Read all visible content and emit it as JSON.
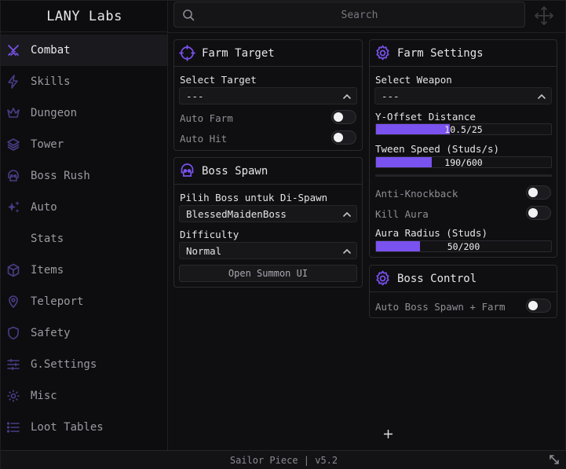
{
  "app": {
    "title": "LANY Labs"
  },
  "colors": {
    "accent": "#7a52ef",
    "background": "#0f0f11",
    "panel_border": "#2a2a2e"
  },
  "search": {
    "placeholder": "Search"
  },
  "sidebar": {
    "items": [
      {
        "label": "Combat",
        "icon": "swords-icon",
        "active": true
      },
      {
        "label": "Skills",
        "icon": "lightning-icon"
      },
      {
        "label": "Dungeon",
        "icon": "crown-icon"
      },
      {
        "label": "Tower",
        "icon": "layers-icon"
      },
      {
        "label": "Boss Rush",
        "icon": "skull-icon"
      },
      {
        "label": "Auto",
        "icon": "sparkles-icon"
      },
      {
        "label": "Stats",
        "icon": ""
      },
      {
        "label": "Items",
        "icon": "cube-icon"
      },
      {
        "label": "Teleport",
        "icon": "map-pin-icon"
      },
      {
        "label": "Safety",
        "icon": "shield-icon"
      },
      {
        "label": "G.Settings",
        "icon": "sliders-icon"
      },
      {
        "label": "Misc",
        "icon": "gear-icon"
      },
      {
        "label": "Loot Tables",
        "icon": "list-icon"
      }
    ]
  },
  "farm_target": {
    "title": "Farm Target",
    "select_target_label": "Select Target",
    "select_target_value": "---",
    "auto_farm_label": "Auto Farm",
    "auto_farm_on": false,
    "auto_hit_label": "Auto Hit",
    "auto_hit_on": false
  },
  "boss_spawn": {
    "title": "Boss Spawn",
    "boss_label": "Pilih Boss untuk Di-Spawn",
    "boss_value": "BlessedMaidenBoss",
    "difficulty_label": "Difficulty",
    "difficulty_value": "Normal",
    "summon_button": "Open Summon UI"
  },
  "farm_settings": {
    "title": "Farm Settings",
    "weapon_label": "Select Weapon",
    "weapon_value": "---",
    "y_offset_label": "Y-Offset Distance",
    "y_offset_value": 10.5,
    "y_offset_max": 25,
    "y_offset_text": "10.5/25",
    "tween_label": "Tween Speed (Studs/s)",
    "tween_value": 190,
    "tween_max": 600,
    "tween_text": "190/600",
    "anti_knockback_label": "Anti-Knockback",
    "anti_knockback_on": false,
    "kill_aura_label": "Kill Aura",
    "kill_aura_on": false,
    "aura_radius_label": "Aura Radius (Studs)",
    "aura_radius_value": 50,
    "aura_radius_max": 200,
    "aura_radius_text": "50/200"
  },
  "boss_control": {
    "title": "Boss Control",
    "auto_spawn_label": "Auto Boss Spawn + Farm",
    "auto_spawn_on": false
  },
  "status": {
    "text": "Sailor Piece | v5.2"
  }
}
